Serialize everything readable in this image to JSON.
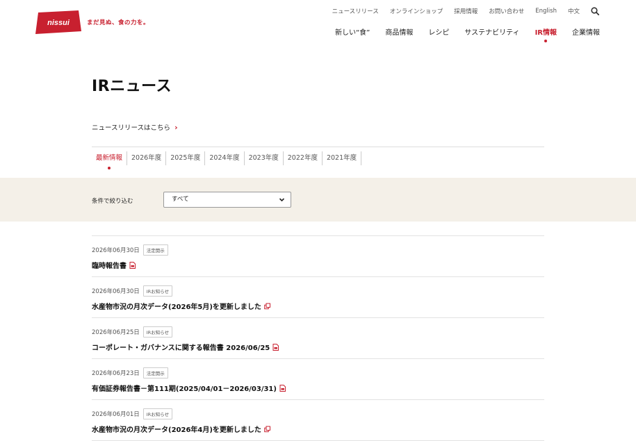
{
  "header": {
    "brand": "nissui",
    "tagline": "まだ見ぬ、食の力を。",
    "util_nav": [
      "ニュースリリース",
      "オンラインショップ",
      "採用情報",
      "お問い合わせ",
      "English",
      "中文"
    ],
    "main_nav": [
      {
        "label": "新しい“食”",
        "active": false
      },
      {
        "label": "商品情報",
        "active": false
      },
      {
        "label": "レシピ",
        "active": false
      },
      {
        "label": "サステナビリティ",
        "active": false
      },
      {
        "label": "IR情報",
        "active": true
      },
      {
        "label": "企業情報",
        "active": false
      }
    ]
  },
  "page": {
    "title": "IRニュース",
    "press_link": "ニュースリリースはこちら"
  },
  "tabs": [
    {
      "label": "最新情報",
      "active": true
    },
    {
      "label": "2026年度",
      "active": false
    },
    {
      "label": "2025年度",
      "active": false
    },
    {
      "label": "2024年度",
      "active": false
    },
    {
      "label": "2023年度",
      "active": false
    },
    {
      "label": "2022年度",
      "active": false
    },
    {
      "label": "2021年度",
      "active": false
    }
  ],
  "filter": {
    "label": "条件で絞り込む",
    "selected": "すべて"
  },
  "news": [
    {
      "date": "2026年06月30日",
      "category": "法定開示",
      "title": "臨時報告書",
      "icon": "pdf-icon"
    },
    {
      "date": "2026年06月30日",
      "category": "IRお知らせ",
      "title": "水産物市況の月次データ(2026年5月)を更新しました",
      "icon": "external-link-icon"
    },
    {
      "date": "2026年06月25日",
      "category": "IRお知らせ",
      "title": "コーポレート・ガバナンスに関する報告書 2026/06/25",
      "icon": "pdf-icon"
    },
    {
      "date": "2026年06月23日",
      "category": "法定開示",
      "title": "有価証券報告書－第111期(2025/04/01－2026/03/31)",
      "icon": "pdf-icon"
    },
    {
      "date": "2026年06月01日",
      "category": "IRお知らせ",
      "title": "水産物市況の月次データ(2026年4月)を更新しました",
      "icon": "external-link-icon"
    }
  ],
  "colors": {
    "accent": "#c8202f",
    "filter_bg": "#f4f0e8"
  }
}
